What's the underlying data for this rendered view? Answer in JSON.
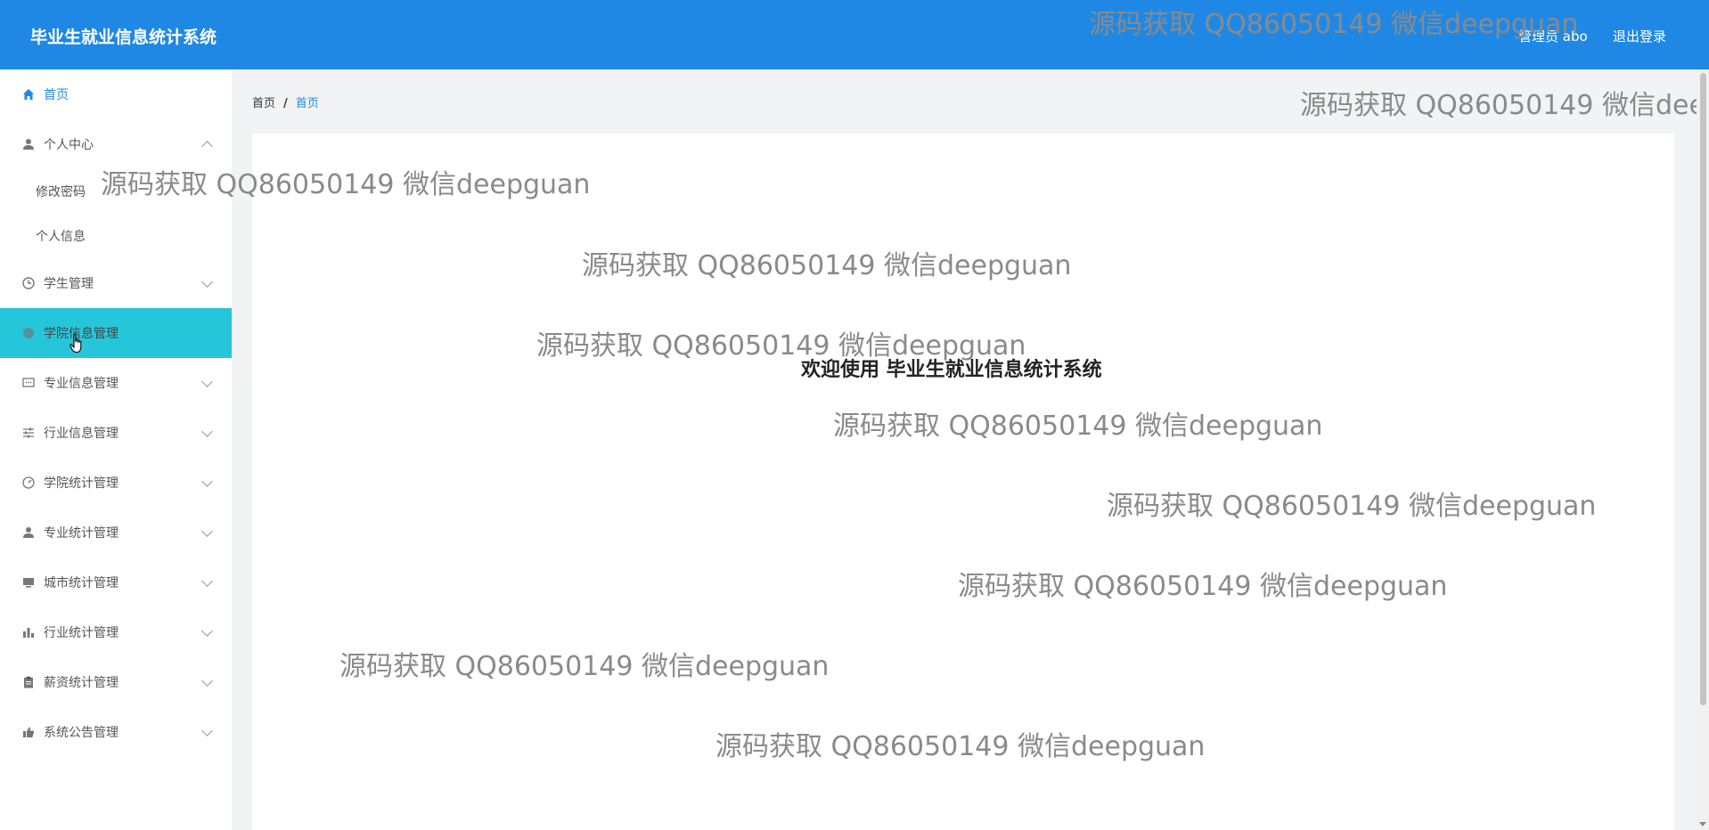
{
  "header": {
    "title": "毕业生就业信息统计系统",
    "user_label": "管理员 abo",
    "logout_label": "退出登录"
  },
  "sidebar": {
    "items": [
      {
        "label": "首页",
        "icon": "home-icon",
        "expandable": false
      },
      {
        "label": "个人中心",
        "icon": "user-icon",
        "expandable": true,
        "expanded": true,
        "children": [
          {
            "label": "修改密码"
          },
          {
            "label": "个人信息"
          }
        ]
      },
      {
        "label": "学生管理",
        "icon": "clock-icon",
        "expandable": true
      },
      {
        "label": "学院信息管理",
        "icon": "circle-icon",
        "expandable": true,
        "hovered": true
      },
      {
        "label": "专业信息管理",
        "icon": "chat-icon",
        "expandable": true
      },
      {
        "label": "行业信息管理",
        "icon": "sliders-icon",
        "expandable": true
      },
      {
        "label": "学院统计管理",
        "icon": "gauge-icon",
        "expandable": true
      },
      {
        "label": "专业统计管理",
        "icon": "user-icon",
        "expandable": true
      },
      {
        "label": "城市统计管理",
        "icon": "monitor-icon",
        "expandable": true
      },
      {
        "label": "行业统计管理",
        "icon": "bar-chart-icon",
        "expandable": true
      },
      {
        "label": "薪资统计管理",
        "icon": "clipboard-icon",
        "expandable": true
      },
      {
        "label": "系统公告管理",
        "icon": "thumb-icon",
        "expandable": true
      }
    ]
  },
  "breadcrumb": {
    "root": "首页",
    "separator": "/",
    "current": "首页"
  },
  "main": {
    "welcome": "欢迎使用 毕业生就业信息统计系统"
  },
  "watermark_text": "源码获取 QQ86050149 微信deepguan",
  "colors": {
    "header_bg": "#1f88e5",
    "accent": "#1f88e5",
    "hover_bg": "#26c6da",
    "content_bg": "#f2f3f5"
  }
}
